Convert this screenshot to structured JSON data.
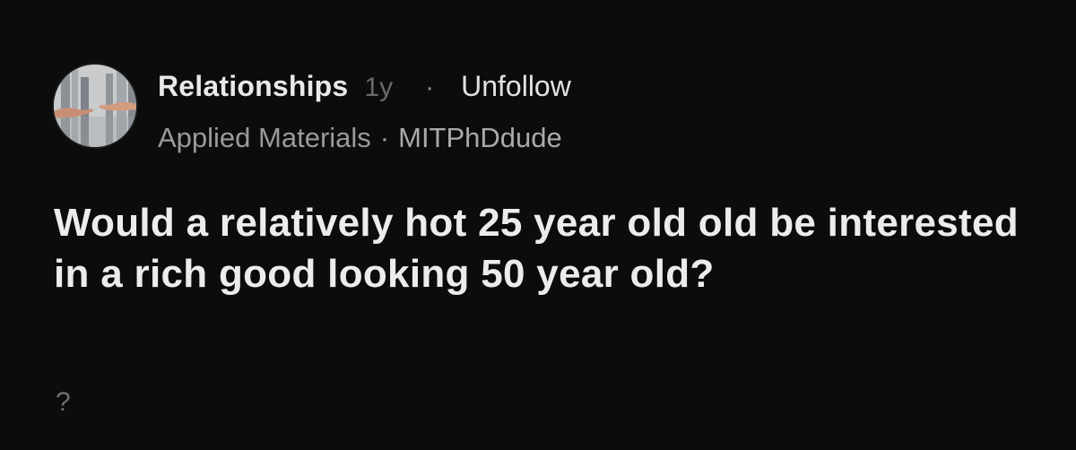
{
  "post": {
    "community": "Relationships",
    "age": "1y",
    "separator": "·",
    "follow_label": "Unfollow",
    "company": "Applied Materials",
    "author_separator": "·",
    "username": "MITPhDdude",
    "title": "Would a relatively hot 25 year old old be interested in a rich good looking 50 year old?",
    "body": "?",
    "avatar_icon": "reaching-hands-icon"
  }
}
